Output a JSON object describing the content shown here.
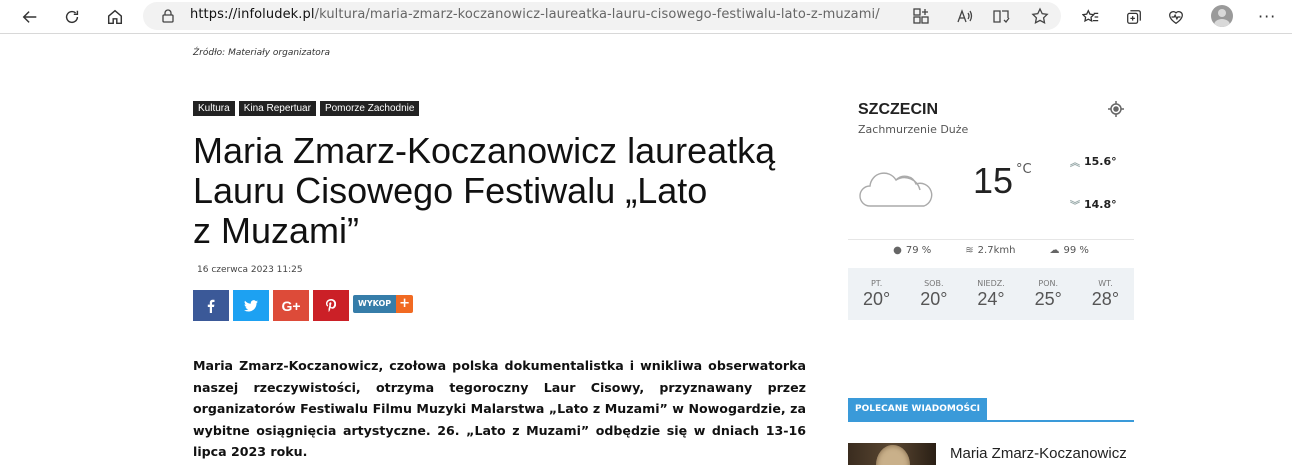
{
  "browser": {
    "url_domain": "https://infoludek.pl",
    "url_path": "/kultura/maria-zmarz-koczanowicz-laureatka-lauru-cisowego-festiwalu-lato-z-muzami/"
  },
  "article": {
    "source": "Źródło: Materiały organizatora",
    "tags": [
      "Kultura",
      "Kina Repertuar",
      "Pomorze Zachodnie"
    ],
    "title_lines": [
      "Maria Zmarz-Koczanowicz laureatką",
      "Lauru Cisowego Festiwalu „Lato",
      "z Muzami”"
    ],
    "date": "16 czerwca 2023 11:25",
    "share": {
      "facebook": "f",
      "twitter": "t",
      "google": "G+",
      "pinterest": "P",
      "wykop": "WYKOP",
      "wykop_plus": "+"
    },
    "lead": "Maria Zmarz-Koczanowicz, czołowa polska dokumentalistka i wnikliwa obserwatorka naszej rzeczywistości, otrzyma tegoroczny Laur Cisowy, przyznawany przez organizatorów Festiwalu Filmu Muzyki Malarstwa „Lato z Muzami” w Nowogardzie, za wybitne osiągnięcia artystyczne. 26. „Lato z Muzami” odbędzie się w dniach 13-16 lipca 2023 roku."
  },
  "weather": {
    "city": "SZCZECIN",
    "condition": "Zachmurzenie Duże",
    "temp": "15",
    "unit": "°C",
    "high": "15.6°",
    "low": "14.8°",
    "humidity": "79 %",
    "wind": "2.7kmh",
    "clouds": "99 %",
    "days": [
      {
        "name": "PT.",
        "temp": "20°"
      },
      {
        "name": "SOB.",
        "temp": "20°"
      },
      {
        "name": "NIEDZ.",
        "temp": "24°"
      },
      {
        "name": "PON.",
        "temp": "25°"
      },
      {
        "name": "WT.",
        "temp": "28°"
      }
    ]
  },
  "recommended": {
    "header": "POLECANE WIADOMOŚCI",
    "items": [
      {
        "title": "Maria Zmarz-Koczanowicz"
      }
    ]
  }
}
